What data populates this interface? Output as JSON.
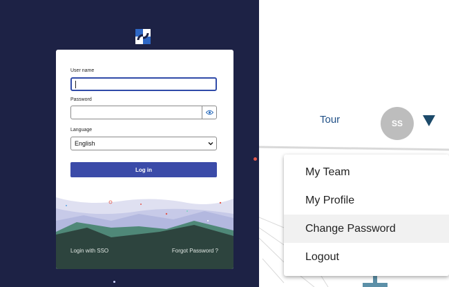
{
  "login": {
    "username_label": "User name",
    "username_value": "",
    "password_label": "Password",
    "password_value": "",
    "language_label": "Language",
    "language_selected": "English",
    "login_button": "Log in",
    "sso_link": "Login with SSO",
    "forgot_link": "Forgot Password ?"
  },
  "header": {
    "tour": "Tour",
    "avatar_initials": "SS"
  },
  "user_menu": {
    "items": [
      {
        "label": "My Team"
      },
      {
        "label": "My Profile"
      },
      {
        "label": "Change Password"
      },
      {
        "label": "Logout"
      }
    ]
  },
  "icons": {
    "logo": "app-logo",
    "password_toggle": "eye-icon",
    "select_arrow": "chevron-down-icon",
    "avatar_caret": "caret-down-icon"
  },
  "colors": {
    "login_background": "#1d2245",
    "login_button": "#3b4ba8",
    "link_text": "#1f4f86",
    "avatar": "#bdbdbd",
    "caret": "#1c4a6a",
    "landscape_dark": "#2d443e"
  }
}
